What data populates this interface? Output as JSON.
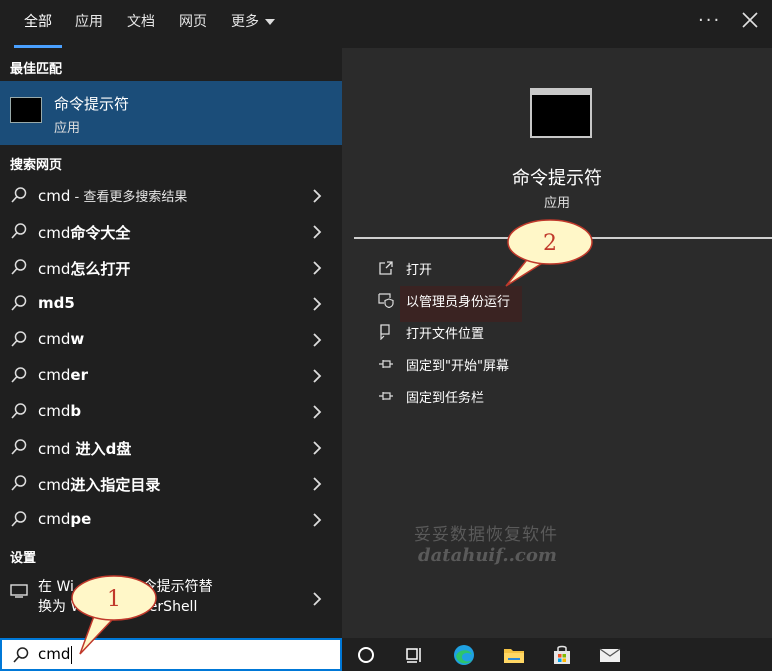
{
  "tabs": [
    {
      "label": "全部",
      "active": true
    },
    {
      "label": "应用",
      "active": false
    },
    {
      "label": "文档",
      "active": false
    },
    {
      "label": "网页",
      "active": false
    },
    {
      "label": "更多",
      "active": false
    }
  ],
  "header": {
    "more_options": "···"
  },
  "best_match": {
    "header": "最佳匹配",
    "title": "命令提示符",
    "subtitle": "应用"
  },
  "web_search": {
    "header": "搜索网页",
    "items": [
      {
        "prefix": "cmd",
        "suffix": " - 查看更多搜索结果"
      },
      {
        "prefix": "cmd",
        "suffix": "命令大全"
      },
      {
        "prefix": "cmd",
        "suffix": "怎么打开"
      },
      {
        "prefix": "",
        "suffix": "md5"
      },
      {
        "prefix": "cmd",
        "suffix": "w"
      },
      {
        "prefix": "cmd",
        "suffix": "er"
      },
      {
        "prefix": "cmd",
        "suffix": "b"
      },
      {
        "prefix": "cmd",
        "suffix": " 进入d盘"
      },
      {
        "prefix": "cmd",
        "suffix": "进入指定目录"
      },
      {
        "prefix": "cmd",
        "suffix": "pe"
      }
    ]
  },
  "settings": {
    "header": "设置",
    "line1": "在 Wi      中将命令提示符替",
    "line2": "换为 W          owerShell"
  },
  "preview": {
    "title": "命令提示符",
    "type": "应用",
    "actions": [
      {
        "label": "打开",
        "icon": "open-icon"
      },
      {
        "label": "以管理员身份运行",
        "icon": "shield-icon"
      },
      {
        "label": "打开文件位置",
        "icon": "file-location-icon"
      },
      {
        "label": "固定到\"开始\"屏幕",
        "icon": "pin-icon"
      },
      {
        "label": "固定到任务栏",
        "icon": "pin-icon"
      }
    ]
  },
  "watermark": {
    "line1": "妥妥数据恢复软件",
    "line2": "datahuif..com"
  },
  "search": {
    "value": "cmd"
  },
  "callouts": {
    "one": "1",
    "two": "2"
  },
  "colors": {
    "accent": "#0078d7",
    "highlight": "#1b4d79",
    "callout_fill": "#fff7c8",
    "callout_text": "#c0392b"
  }
}
